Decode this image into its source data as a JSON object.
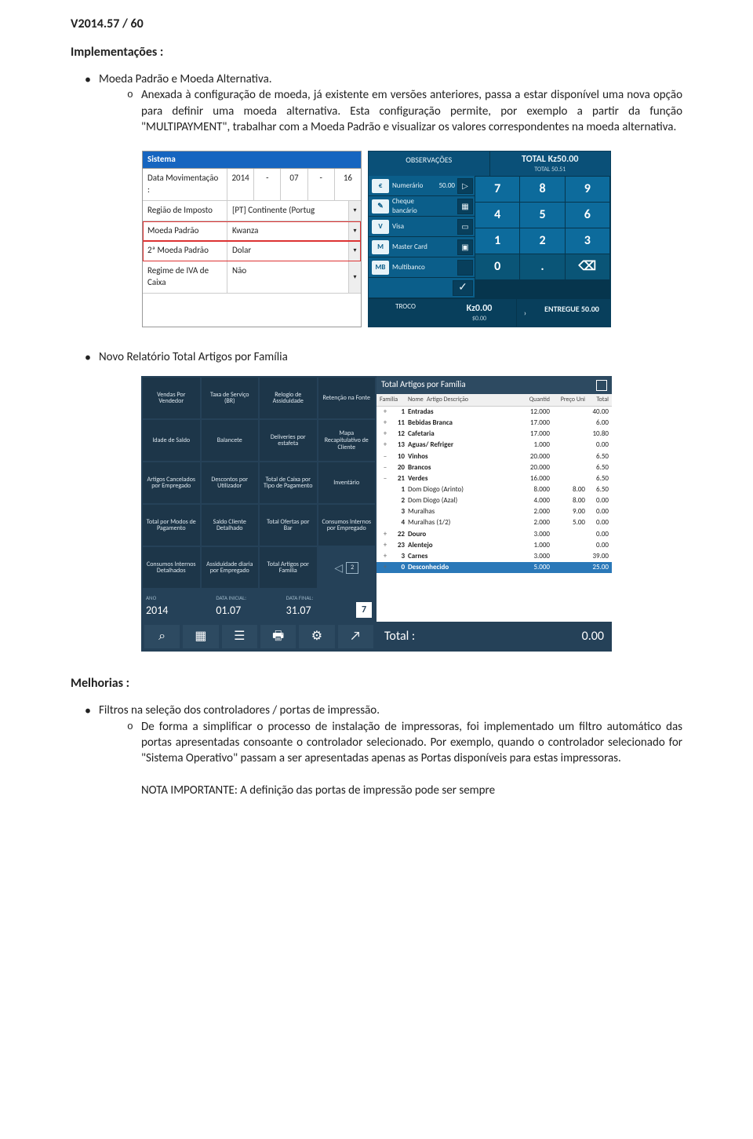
{
  "doc": {
    "version_title": "V2014.57 / 60",
    "impl_heading": "Implementações :",
    "bullet1_title": "Moeda Padrão e Moeda Alternativa.",
    "bullet1_body": "Anexada à configuração de moeda, já existente em versões anteriores, passa a estar disponível uma nova opção para definir uma moeda alternativa. Esta configuração permite, por exemplo a partir da função \"MULTIPAYMENT\", trabalhar com a Moeda Padrão e visualizar os valores correspondentes na moeda alternativa.",
    "bullet2_title": "Novo Relatório Total Artigos por Família",
    "improv_heading": "Melhorias :",
    "bullet3_title": "Filtros na seleção dos controladores / portas de impressão.",
    "bullet3_body": "De forma a simplificar o processo de instalação de impressoras, foi implementado um filtro automático das portas apresentadas consoante o controlador selecionado. Por exemplo, quando o controlador selecionado for \"Sistema Operativo\" passam a ser apresentadas apenas as Portas disponíveis para estas impressoras.",
    "bullet3_note": "NOTA IMPORTANTE: A definição das portas de impressão pode ser sempre"
  },
  "sistema": {
    "title": "Sistema",
    "rows": [
      {
        "label": "Data Movimentação :",
        "segments": [
          "2014",
          "-",
          "07",
          "-",
          "16"
        ]
      },
      {
        "label": "Região de Imposto",
        "value": "[PT] Continente (Portug",
        "dd": true
      },
      {
        "label": "Moeda Padrão",
        "value": "Kwanza",
        "dd": true,
        "hl": true
      },
      {
        "label": "2ª Moeda Padrão",
        "value": "Dolar",
        "dd": true,
        "hl": true
      },
      {
        "label": "Regime de IVA de Caixa",
        "value": "Não",
        "dd": true
      }
    ]
  },
  "pay": {
    "obs": "OBSERVAÇÕES",
    "total_label": "TOTAL Kz50.00",
    "total_sub": "TOTAL 50.51",
    "methods": [
      {
        "ic": "€",
        "lab": "Numerário",
        "amt": "50.00",
        "btn": "▷"
      },
      {
        "ic": "✎",
        "lab": "Cheque bancário",
        "amt": "",
        "btn": "▦"
      },
      {
        "ic": "V",
        "lab": "Visa",
        "amt": "",
        "btn": "▭"
      },
      {
        "ic": "M",
        "lab": "Master Card",
        "amt": "",
        "btn": "▣"
      },
      {
        "ic": "MB",
        "lab": "Multibanco",
        "amt": "",
        "btn": ""
      }
    ],
    "keys": [
      "7",
      "8",
      "9",
      "4",
      "5",
      "6",
      "1",
      "2",
      "3",
      "0",
      ".",
      "⌫"
    ],
    "check": "✓",
    "troco_label": "TROCO",
    "troco_big": "Kz0.00",
    "troco_sm": "$0.00",
    "chev": "›",
    "entregue": "ENTREGUE 50.00"
  },
  "reports": {
    "tiles": [
      "Vendas Por Vendedor",
      "Taxa de Serviço (BR)",
      "Relogio de Assiduidade",
      "Retenção na Fonte",
      "Idade de Saldo",
      "Balancete",
      "Deliveries por estafeta",
      "Mapa Recapitulativo de Cliente",
      "Artigos Cancelados por Empregado",
      "Descontos por Utilizador",
      "Total de Caixa por Tipo de Pagamento",
      "Inventário",
      "Total por Modos de Pagamento",
      "Saldo Cliente Detalhado",
      "Total Ofertas por Bar",
      "Consumos Internos por Empregado",
      "Consumos Internos Detalhados",
      "Assiduidade diaria por Empregado",
      "Total Artigos por Familia"
    ],
    "page": "2",
    "date_labels": {
      "ano": "ANO",
      "di": "DATA INICIAL:",
      "df": "DATA FINAL:"
    },
    "dates": {
      "ano": "2014",
      "di": "01.07",
      "df": "31.07"
    },
    "cal": "7",
    "panel_title": "Total Artigos por Família",
    "cols": [
      "Família",
      "Nome",
      "Artigo Descrição",
      "Quantid",
      "Preço Uni",
      "Total"
    ],
    "rows": [
      {
        "exp": "+",
        "id": "1",
        "name": "Entradas",
        "q": "12.000",
        "p": "",
        "t": "40.00"
      },
      {
        "exp": "+",
        "id": "11",
        "name": "Bebidas Branca",
        "q": "17.000",
        "p": "",
        "t": "6.00"
      },
      {
        "exp": "+",
        "id": "12",
        "name": "Cafetaria",
        "q": "17.000",
        "p": "",
        "t": "10.80"
      },
      {
        "exp": "+",
        "id": "13",
        "name": "Aguas/ Refriger",
        "q": "1.000",
        "p": "",
        "t": "0.00"
      },
      {
        "exp": "–",
        "id": "10",
        "name": "Vinhos",
        "q": "20.000",
        "p": "",
        "t": "6.50"
      },
      {
        "exp": "–",
        "id": "20",
        "name": "Brancos",
        "q": "20.000",
        "p": "",
        "t": "6.50"
      },
      {
        "exp": "–",
        "id": "21",
        "name": "Verdes",
        "q": "16.000",
        "p": "",
        "t": "6.50"
      },
      {
        "exp": "",
        "id": "1",
        "name": "Dom Diogo (Arinto)",
        "q": "8.000",
        "p": "8.00",
        "t": "6.50",
        "child": true
      },
      {
        "exp": "",
        "id": "2",
        "name": "Dom Diogo (Azal)",
        "q": "4.000",
        "p": "8.00",
        "t": "0.00",
        "child": true
      },
      {
        "exp": "",
        "id": "3",
        "name": "Muralhas",
        "q": "2.000",
        "p": "9.00",
        "t": "0.00",
        "child": true
      },
      {
        "exp": "",
        "id": "4",
        "name": "Muralhas (1/2)",
        "q": "2.000",
        "p": "5.00",
        "t": "0.00",
        "child": true
      },
      {
        "exp": "+",
        "id": "22",
        "name": "Douro",
        "q": "3.000",
        "p": "",
        "t": "0.00"
      },
      {
        "exp": "+",
        "id": "23",
        "name": "Alentejo",
        "q": "1.000",
        "p": "",
        "t": "0.00"
      },
      {
        "exp": "+",
        "id": "3",
        "name": "Carnes",
        "q": "3.000",
        "p": "",
        "t": "39.00"
      },
      {
        "exp": "+",
        "id": "0",
        "name": "Desconhecido",
        "q": "5.000",
        "p": "",
        "t": "25.00",
        "sel": true
      }
    ],
    "total_label": "Total :",
    "total_value": "0.00",
    "toolbar": [
      "⌕",
      "▦",
      "☰",
      "🖶",
      "⚙",
      "↗"
    ]
  }
}
